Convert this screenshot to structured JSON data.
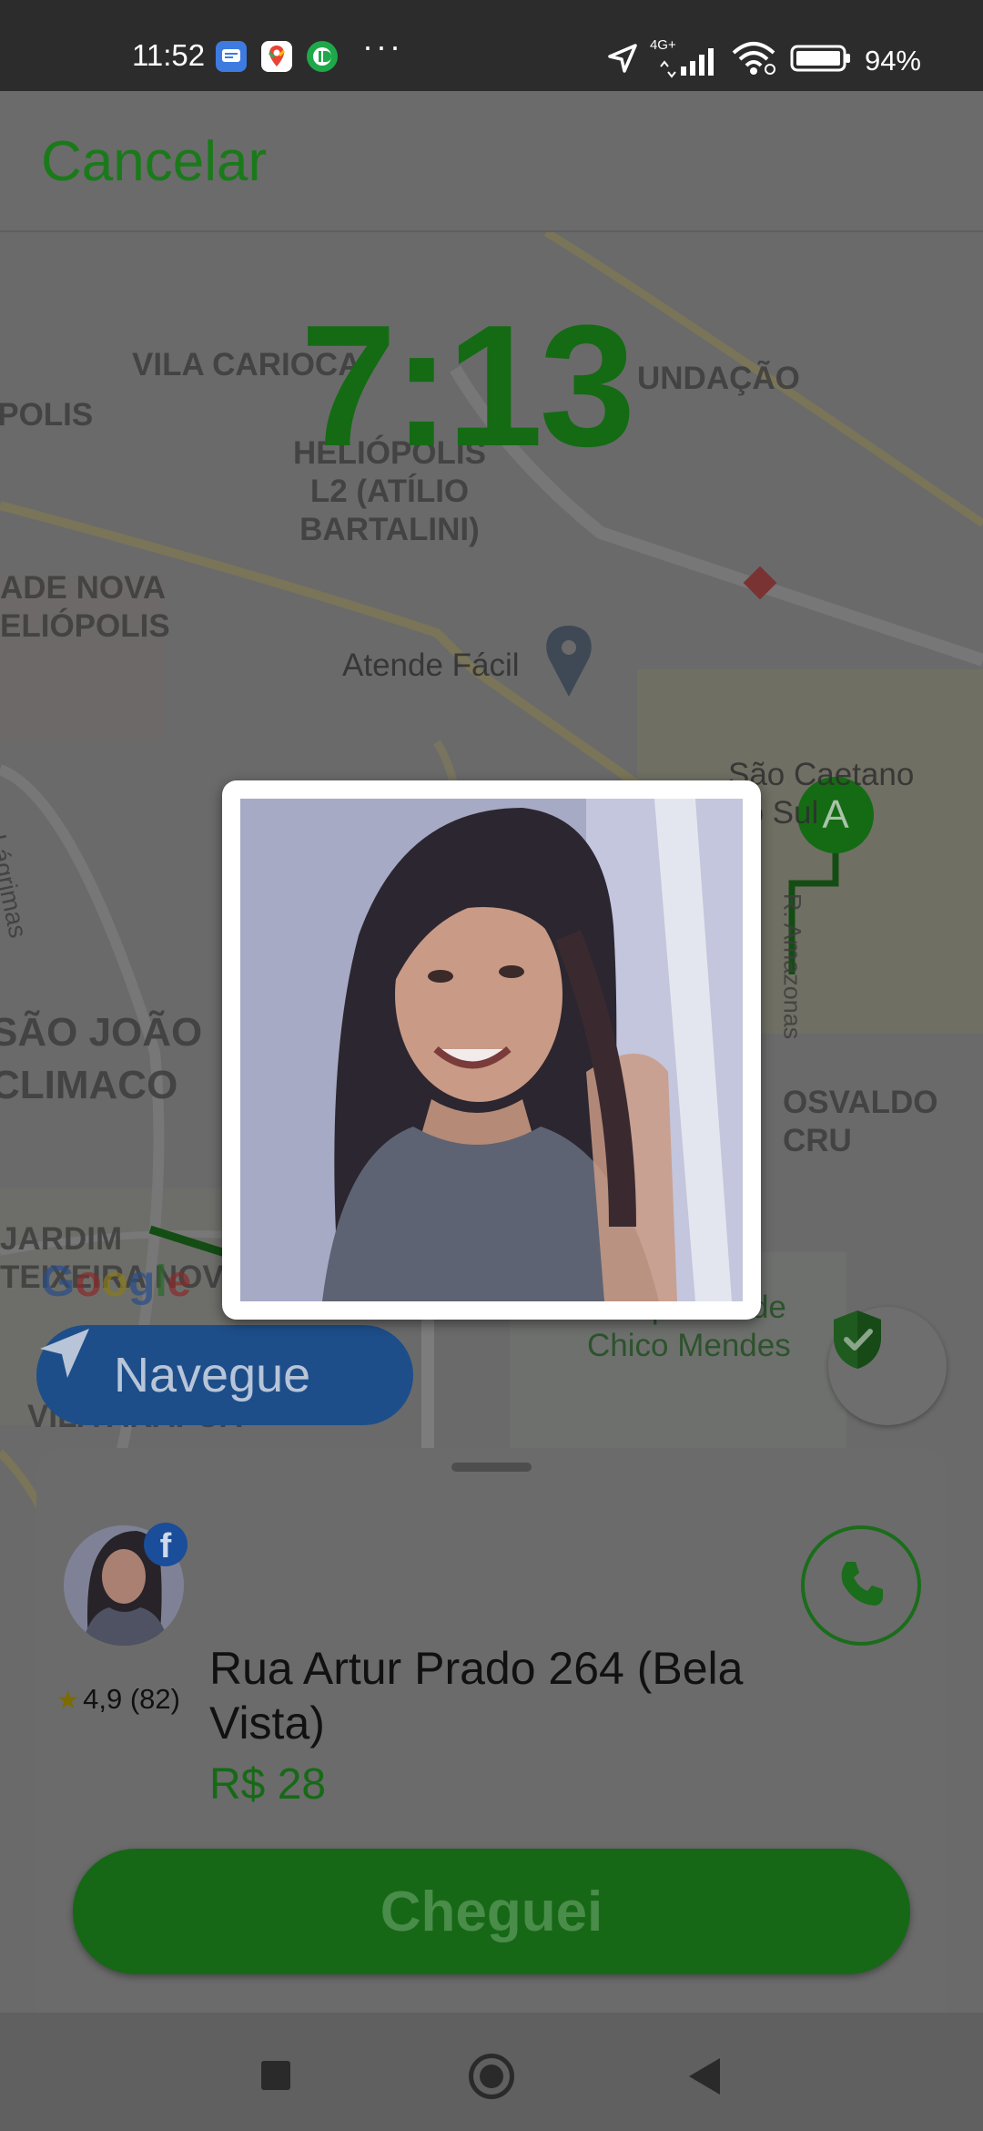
{
  "status_bar": {
    "time": "11:52",
    "dots": "···",
    "network": "4G+",
    "battery": "94%",
    "icons": [
      "messages-icon",
      "maps-icon",
      "app-icon",
      "location-arrow-icon",
      "signal-icon",
      "wifi-icon",
      "battery-icon"
    ]
  },
  "header": {
    "cancel_label": "Cancelar"
  },
  "map": {
    "timer": "7:13",
    "labels": {
      "vila_carioca": "VILA CARIOCA",
      "polis": "OPOLIS",
      "heliopolis_l2": "HELIÓPOLIS\nL2 (ATÍLIO\nBARTALINI)",
      "ndacao": "UNDAÇÃO",
      "ade_nova": "ADE NOVA\nELIÓPOLIS",
      "atende_facil": "Atende Fácil",
      "estr_lagrimas": "Estr. das Lágrimas",
      "sao_caetano": "São Caetano\ndo Sul",
      "r_amazonas": "R. Amazonas",
      "sao_joao": "SÃO JOÃO\nCLIMACO",
      "osvaldo": "OSVALDO CRU",
      "jardim": "JARDIM\nTEIXEIRA NOVO",
      "parque_verde": "Parque Verde\nChico Mendes",
      "vila_arapua": "VILA ARAPUÃ",
      "marker": "A"
    },
    "google_logo": "Google",
    "navegue_label": "Navegue"
  },
  "driver_sheet": {
    "fb_badge": "f",
    "rating": "4,9 (82)",
    "address": "Rua Artur Prado 264 (Bela Vista)",
    "price": "R$ 28",
    "action_label": "Cheguei"
  },
  "colors": {
    "accent": "#1a7a1a",
    "nav_blue": "#1d4e8a",
    "overlay": "#6b6b6b"
  }
}
